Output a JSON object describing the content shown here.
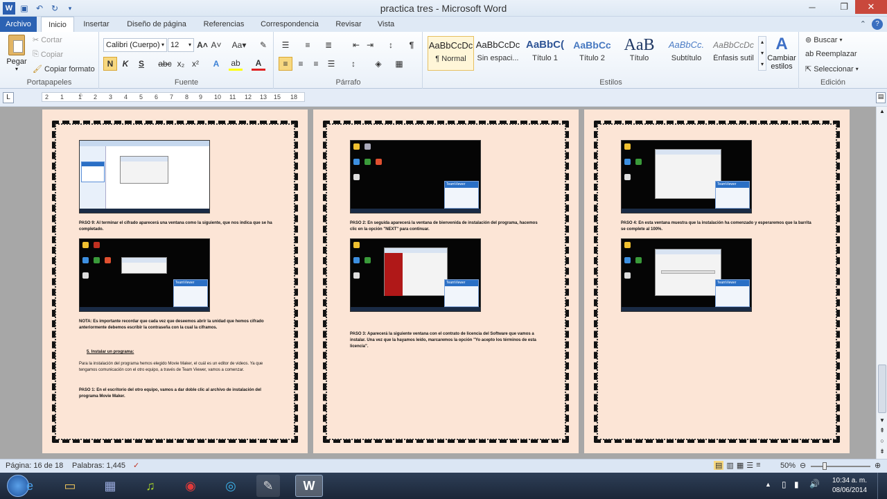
{
  "titlebar": {
    "title": "practica tres - Microsoft Word",
    "help": "?"
  },
  "tabs": [
    "Archivo",
    "Inicio",
    "Insertar",
    "Diseño de página",
    "Referencias",
    "Correspondencia",
    "Revisar",
    "Vista"
  ],
  "clipboard": {
    "paste": "Pegar",
    "cut": "Cortar",
    "copy": "Copiar",
    "format": "Copiar formato",
    "label": "Portapapeles"
  },
  "font": {
    "name": "Calibri (Cuerpo)",
    "size": "12",
    "bold": "N",
    "italic": "K",
    "underline": "S",
    "strike": "abc",
    "sub": "x₂",
    "sup": "x²",
    "case": "Aa",
    "label": "Fuente"
  },
  "paragraph": {
    "label": "Párrafo",
    "pilcrow": "¶"
  },
  "styles": {
    "label": "Estilos",
    "items": [
      {
        "preview": "AaBbCcDc",
        "name": "¶ Normal"
      },
      {
        "preview": "AaBbCcDc",
        "name": "Sin espaci..."
      },
      {
        "preview": "AaBbC(",
        "name": "Título 1"
      },
      {
        "preview": "AaBbCc",
        "name": "Título 2"
      },
      {
        "preview": "AaB",
        "name": "Título"
      },
      {
        "preview": "AaBbCc.",
        "name": "Subtítulo"
      },
      {
        "preview": "AaBbCcDc",
        "name": "Énfasis sutil"
      }
    ],
    "change_line1": "Cambiar",
    "change_line2": "estilos"
  },
  "editing": {
    "find": "Buscar",
    "replace": "Reemplazar",
    "select": "Seleccionar",
    "label": "Edición"
  },
  "ruler": [
    "2",
    "1",
    "1",
    "2",
    "3",
    "4",
    "5",
    "6",
    "7",
    "8",
    "9",
    "10",
    "11",
    "12",
    "13",
    "14",
    "15",
    "16",
    "18"
  ],
  "pages": [
    {
      "para1": "PASO 9: Al terminar el cifrado aparecerá una ventana como la siguiente, que nos indica que se ha completado.",
      "para2": "NOTA: Es importante recordar que cada vez que deseemos abrir la unidad que hemos cifrado anteriormente debemos escribir la contraseña con la cual la ciframos.",
      "heading": "5.     Instalar un programa:",
      "para3": "Para la instalación del programa  hemos elegido Movie Maker, el cuál es un editor de videos.                    Ya que tengamos comunicación con el otro equipo, a través de Team Viewer, vamos a comenzar.",
      "para4": "PASO 1: En el escritorio del otro equipo, vamos a dar doble clic al archivo de instalación del programa Movie Maker."
    },
    {
      "para1": "PASO 2: En seguida aparecerá la ventana de bienvenida de instalación del programa, hacemos clic en la opción \"NEXT\" para continuar.",
      "para2": "PASO 3: Aparecerá la siguiente ventana con el contrato de licencia del Software que vamos a instalar. Una vez que la hayamos leído, marcaremos la opción \"Yo acepto los términos de esta licencia\"."
    },
    {
      "para1": "PASO 4: En esta ventana muestra que la instalación ha comenzado y esperaremos que la barrita se complete al 100%."
    }
  ],
  "teamviewer": "TeamViewer",
  "status": {
    "page": "Página: 16 de 18",
    "words": "Palabras: 1,445",
    "zoom": "50%"
  },
  "taskbar": {
    "time": "10:34 a. m.",
    "date": "08/06/2014"
  }
}
